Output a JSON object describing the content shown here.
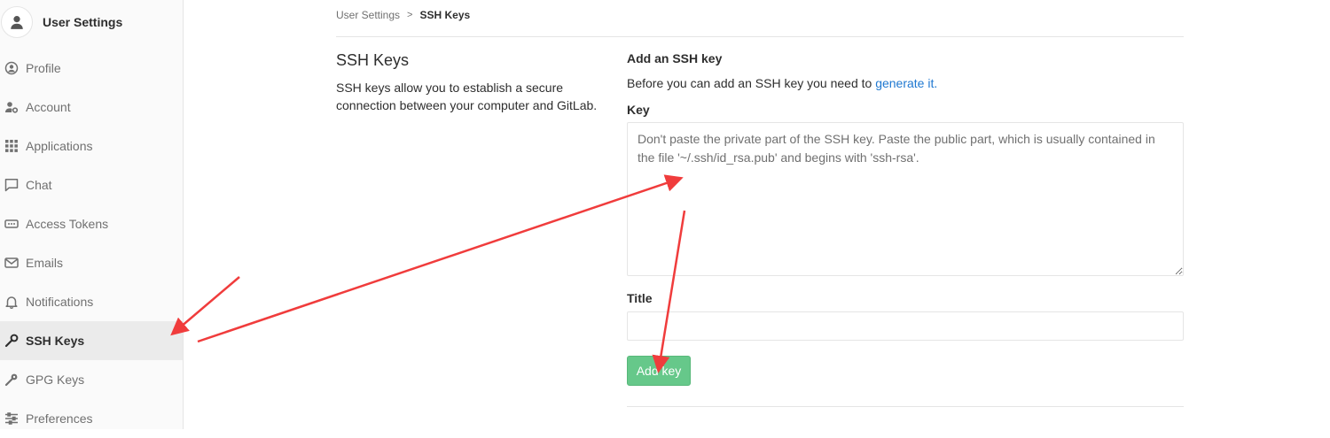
{
  "sidebar": {
    "title": "User Settings",
    "items": [
      {
        "label": "Profile",
        "icon": "profile-icon"
      },
      {
        "label": "Account",
        "icon": "account-gear-icon"
      },
      {
        "label": "Applications",
        "icon": "applications-grid-icon"
      },
      {
        "label": "Chat",
        "icon": "chat-icon"
      },
      {
        "label": "Access Tokens",
        "icon": "access-tokens-icon"
      },
      {
        "label": "Emails",
        "icon": "envelope-icon"
      },
      {
        "label": "Notifications",
        "icon": "bell-icon"
      },
      {
        "label": "SSH Keys",
        "icon": "key-icon",
        "active": true
      },
      {
        "label": "GPG Keys",
        "icon": "key-icon"
      },
      {
        "label": "Preferences",
        "icon": "sliders-icon"
      }
    ]
  },
  "breadcrumb": {
    "parent": "User Settings",
    "separator": ">",
    "current": "SSH Keys"
  },
  "section": {
    "title": "SSH Keys",
    "description": "SSH keys allow you to establish a secure connection between your computer and GitLab."
  },
  "form": {
    "title": "Add an SSH key",
    "help_prefix": "Before you can add an SSH key you need to ",
    "help_link": "generate it.",
    "key_label": "Key",
    "key_placeholder": "Don't paste the private part of the SSH key. Paste the public part, which is usually contained in the file '~/.ssh/id_rsa.pub' and begins with 'ssh-rsa'.",
    "title_label": "Title",
    "title_value": "",
    "submit_label": "Add key"
  },
  "colors": {
    "link": "#1f78d1",
    "submit": "#66c88a",
    "annotation_arrow": "#f03c3c"
  }
}
